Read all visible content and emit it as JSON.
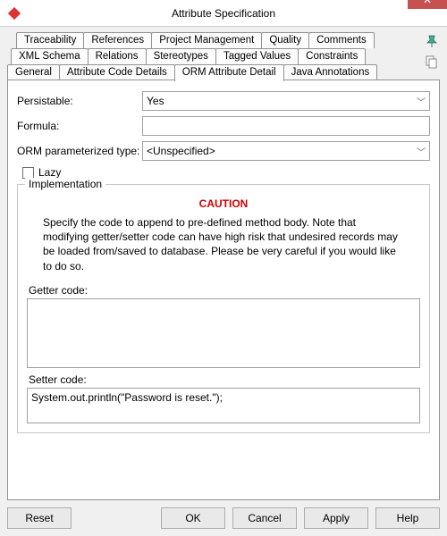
{
  "window": {
    "title": "Attribute Specification",
    "close_icon": "✕"
  },
  "tabs": {
    "row1": [
      "Traceability",
      "References",
      "Project Management",
      "Quality",
      "Comments"
    ],
    "row2": [
      "XML Schema",
      "Relations",
      "Stereotypes",
      "Tagged Values",
      "Constraints"
    ],
    "row3": [
      "General",
      "Attribute Code Details",
      "ORM Attribute Detail",
      "Java Annotations"
    ],
    "active": "ORM Attribute Detail"
  },
  "side_icons": {
    "pin": "pin",
    "copy": "copy"
  },
  "plus_label": "+",
  "form": {
    "persistable_label": "Persistable:",
    "persistable_value": "Yes",
    "formula_label": "Formula:",
    "formula_value": "",
    "orm_param_label": "ORM parameterized type:",
    "orm_param_value": "<Unspecified>",
    "lazy_label": "Lazy"
  },
  "impl": {
    "group_title": "Implementation",
    "caution_heading": "CAUTION",
    "caution_text": "Specify the code to append to pre-defined method body. Note that modifying getter/setter code can have high risk that undesired records may be loaded from/saved to database. Please be very careful if you would like to do so.",
    "getter_label": "Getter code:",
    "getter_value": "",
    "setter_label": "Setter code:",
    "setter_value": "System.out.println(\"Password is reset.\");"
  },
  "buttons": {
    "reset": "Reset",
    "ok": "OK",
    "cancel": "Cancel",
    "apply": "Apply",
    "help": "Help"
  }
}
